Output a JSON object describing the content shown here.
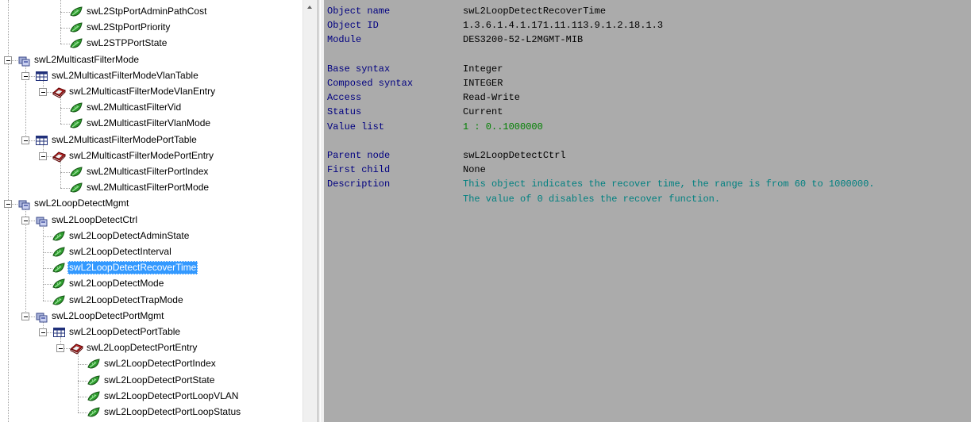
{
  "tree": {
    "nodes": [
      {
        "label": "swL2StpPortAdminPathCost",
        "icon": "leaf-object-icon",
        "depth": 3
      },
      {
        "label": "swL2StpPortPriority",
        "icon": "leaf-object-icon",
        "depth": 3
      },
      {
        "label": "swL2STPPortState",
        "icon": "leaf-object-icon",
        "depth": 3
      },
      {
        "label": "swL2MulticastFilterMode",
        "icon": "folder-group-icon",
        "depth": 0
      },
      {
        "label": "swL2MulticastFilterModeVlanTable",
        "icon": "table-icon",
        "depth": 1
      },
      {
        "label": "swL2MulticastFilterModeVlanEntry",
        "icon": "entry-icon",
        "depth": 2
      },
      {
        "label": "swL2MulticastFilterVid",
        "icon": "leaf-object-icon",
        "depth": 3
      },
      {
        "label": "swL2MulticastFilterVlanMode",
        "icon": "leaf-object-icon",
        "depth": 3
      },
      {
        "label": "swL2MulticastFilterModePortTable",
        "icon": "table-icon",
        "depth": 1
      },
      {
        "label": "swL2MulticastFilterModePortEntry",
        "icon": "entry-icon",
        "depth": 2
      },
      {
        "label": "swL2MulticastFilterPortIndex",
        "icon": "leaf-object-icon",
        "depth": 3
      },
      {
        "label": "swL2MulticastFilterPortMode",
        "icon": "leaf-object-icon",
        "depth": 3
      },
      {
        "label": "swL2LoopDetectMgmt",
        "icon": "folder-group-icon",
        "depth": 0
      },
      {
        "label": "swL2LoopDetectCtrl",
        "icon": "folder-group-icon",
        "depth": 1
      },
      {
        "label": "swL2LoopDetectAdminState",
        "icon": "leaf-object-icon",
        "depth": 2
      },
      {
        "label": "swL2LoopDetectInterval",
        "icon": "leaf-object-icon",
        "depth": 2
      },
      {
        "label": "swL2LoopDetectRecoverTime",
        "icon": "leaf-object-icon",
        "depth": 2,
        "selected": true
      },
      {
        "label": "swL2LoopDetectMode",
        "icon": "leaf-object-icon",
        "depth": 2
      },
      {
        "label": "swL2LoopDetectTrapMode",
        "icon": "leaf-object-icon",
        "depth": 2
      },
      {
        "label": "swL2LoopDetectPortMgmt",
        "icon": "folder-group-icon",
        "depth": 1
      },
      {
        "label": "swL2LoopDetectPortTable",
        "icon": "table-icon",
        "depth": 2
      },
      {
        "label": "swL2LoopDetectPortEntry",
        "icon": "entry-icon",
        "depth": 3
      },
      {
        "label": "swL2LoopDetectPortIndex",
        "icon": "leaf-object-icon",
        "depth": 4
      },
      {
        "label": "swL2LoopDetectPortState",
        "icon": "leaf-object-icon",
        "depth": 4
      },
      {
        "label": "swL2LoopDetectPortLoopVLAN",
        "icon": "leaf-object-icon",
        "depth": 4
      },
      {
        "label": "swL2LoopDetectPortLoopStatus",
        "icon": "leaf-object-icon",
        "depth": 4
      }
    ]
  },
  "details": {
    "rows": [
      {
        "key": "Object name",
        "value": "swL2LoopDetectRecoverTime",
        "style": "plain"
      },
      {
        "key": "Object ID",
        "value": "1.3.6.1.4.1.171.11.113.9.1.2.18.1.3",
        "style": "plain"
      },
      {
        "key": "Module",
        "value": "DES3200-52-L2MGMT-MIB",
        "style": "plain"
      },
      {
        "key": "",
        "value": "",
        "style": "plain"
      },
      {
        "key": "Base syntax",
        "value": "Integer",
        "style": "plain"
      },
      {
        "key": "Composed syntax",
        "value": "INTEGER",
        "style": "plain"
      },
      {
        "key": "Access",
        "value": "Read-Write",
        "style": "plain"
      },
      {
        "key": "Status",
        "value": "Current",
        "style": "plain"
      },
      {
        "key": "Value list",
        "value": "1 : 0..1000000",
        "style": "green"
      },
      {
        "key": "",
        "value": "",
        "style": "plain"
      },
      {
        "key": "Parent node",
        "value": "swL2LoopDetectCtrl",
        "style": "plain"
      },
      {
        "key": "First child",
        "value": "None",
        "style": "plain"
      },
      {
        "key": "Description",
        "value": "This object indicates the recover time, the range is from 60 to 1000000.",
        "style": "teal"
      },
      {
        "key": "",
        "value": "The value of 0 disables the recover function.",
        "style": "teal"
      }
    ]
  },
  "colors": {
    "selection": "#3399ff",
    "key_text": "#000080",
    "description_text": "#008080",
    "value_list_text": "#008000",
    "detail_background": "#ababab"
  }
}
